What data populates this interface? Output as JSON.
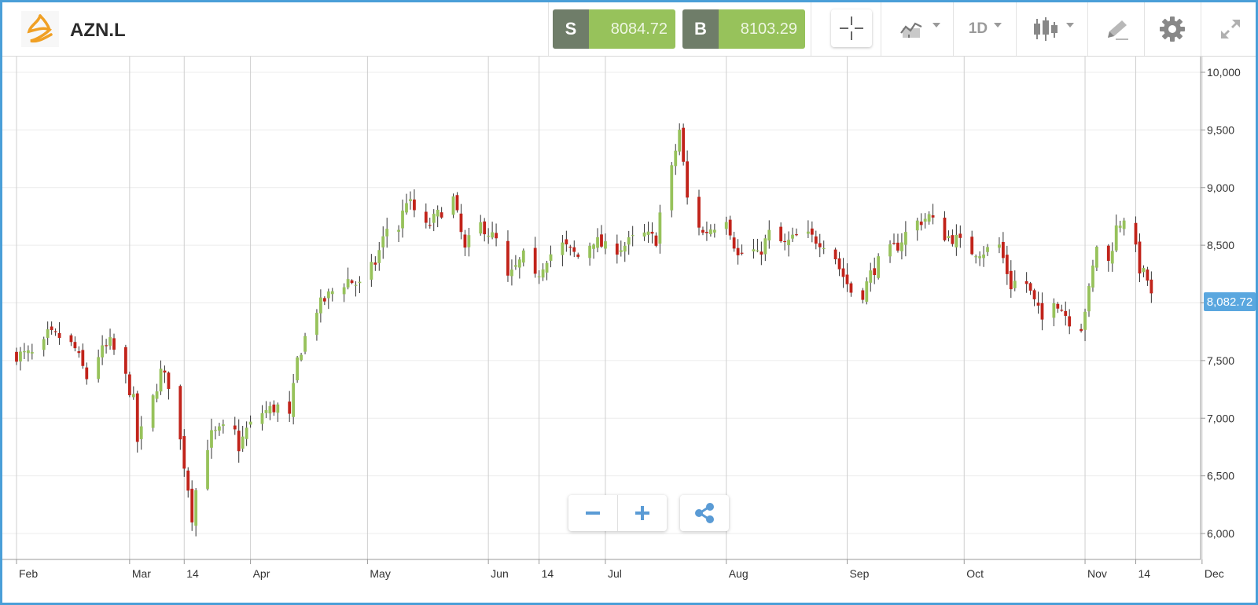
{
  "header": {
    "symbol": "AZN.L"
  },
  "trade": {
    "sell_label": "S",
    "sell_price": "8084.72",
    "buy_label": "B",
    "buy_price": "8103.29"
  },
  "toolbar": {
    "interval": "1D"
  },
  "chart": {
    "current_price_label": "8,082.72",
    "colors": {
      "up": "#97c25b",
      "down": "#c1231a",
      "accent": "#5aa7df",
      "grid": "#ececec",
      "month_line": "#cfcfcf"
    }
  },
  "icons": {
    "logo": "astrazeneca-logo",
    "crosshair": "crosshair-icon",
    "chart_type": "line-chart-icon",
    "candles": "candlestick-icon",
    "draw": "pencil-icon",
    "settings": "gear-icon",
    "expand": "expand-icon",
    "zoom_out": "minus-icon",
    "zoom_in": "plus-icon",
    "share": "share-icon"
  },
  "chart_data": {
    "type": "candlestick",
    "symbol": "AZN.L",
    "ylim": [
      5800,
      10100
    ],
    "yticks": [
      6000,
      6500,
      7000,
      7500,
      8000,
      8500,
      9000,
      9500,
      10000
    ],
    "ytick_labels": [
      "6,000",
      "6,500",
      "7,000",
      "7,500",
      "8,000",
      "8,500",
      "9,000",
      "9,500",
      "10,000"
    ],
    "xticks": [
      {
        "label": "Feb",
        "day": 0
      },
      {
        "label": "Mar",
        "day": 29
      },
      {
        "label": "14",
        "day": 43
      },
      {
        "label": "Apr",
        "day": 60
      },
      {
        "label": "May",
        "day": 90
      },
      {
        "label": "Jun",
        "day": 121
      },
      {
        "label": "14",
        "day": 134
      },
      {
        "label": "Jul",
        "day": 151
      },
      {
        "label": "Aug",
        "day": 182
      },
      {
        "label": "Sep",
        "day": 213
      },
      {
        "label": "Oct",
        "day": 243
      },
      {
        "label": "Nov",
        "day": 274
      },
      {
        "label": "14",
        "day": 287
      },
      {
        "label": "Dec",
        "day": 304
      }
    ],
    "keypoints": [
      [
        0,
        7550
      ],
      [
        6,
        7550
      ],
      [
        8,
        7720
      ],
      [
        12,
        7700
      ],
      [
        15,
        7600
      ],
      [
        18,
        7350
      ],
      [
        21,
        7550
      ],
      [
        24,
        7650
      ],
      [
        27,
        7450
      ],
      [
        30,
        7150
      ],
      [
        31,
        6800
      ],
      [
        34,
        7050
      ],
      [
        37,
        7400
      ],
      [
        39,
        7300
      ],
      [
        41,
        7000
      ],
      [
        44,
        6400
      ],
      [
        45,
        6150
      ],
      [
        47,
        6600
      ],
      [
        50,
        6850
      ],
      [
        53,
        6900
      ],
      [
        55,
        7000
      ],
      [
        57,
        6750
      ],
      [
        59,
        6900
      ],
      [
        63,
        7050
      ],
      [
        67,
        7100
      ],
      [
        70,
        7000
      ],
      [
        72,
        7500
      ],
      [
        74,
        7700
      ],
      [
        77,
        7950
      ],
      [
        81,
        8100
      ],
      [
        85,
        8200
      ],
      [
        88,
        8150
      ],
      [
        92,
        8350
      ],
      [
        96,
        8750
      ],
      [
        98,
        8650
      ],
      [
        100,
        8900
      ],
      [
        103,
        8750
      ],
      [
        105,
        8650
      ],
      [
        109,
        8800
      ],
      [
        112,
        8900
      ],
      [
        115,
        8450
      ],
      [
        118,
        8700
      ],
      [
        120,
        8650
      ],
      [
        124,
        8500
      ],
      [
        126,
        8200
      ],
      [
        130,
        8400
      ],
      [
        133,
        8200
      ],
      [
        136,
        8400
      ],
      [
        140,
        8500
      ],
      [
        144,
        8400
      ],
      [
        148,
        8550
      ],
      [
        152,
        8450
      ],
      [
        156,
        8500
      ],
      [
        160,
        8600
      ],
      [
        164,
        8550
      ],
      [
        166,
        9000
      ],
      [
        168,
        9150
      ],
      [
        170,
        9500
      ],
      [
        172,
        8900
      ],
      [
        174,
        8750
      ],
      [
        176,
        8600
      ],
      [
        178,
        8650
      ],
      [
        182,
        8750
      ],
      [
        185,
        8400
      ],
      [
        188,
        8500
      ],
      [
        190,
        8400
      ],
      [
        193,
        8600
      ],
      [
        197,
        8500
      ],
      [
        201,
        8600
      ],
      [
        205,
        8550
      ],
      [
        209,
        8500
      ],
      [
        211,
        8300
      ],
      [
        214,
        8100
      ],
      [
        216,
        8000
      ],
      [
        219,
        8250
      ],
      [
        222,
        8400
      ],
      [
        226,
        8500
      ],
      [
        228,
        8600
      ],
      [
        231,
        8700
      ],
      [
        234,
        8750
      ],
      [
        237,
        8600
      ],
      [
        241,
        8550
      ],
      [
        244,
        8450
      ],
      [
        248,
        8450
      ],
      [
        252,
        8500
      ],
      [
        255,
        8150
      ],
      [
        258,
        8250
      ],
      [
        261,
        8000
      ],
      [
        263,
        7850
      ],
      [
        266,
        8050
      ],
      [
        270,
        7850
      ],
      [
        273,
        7800
      ],
      [
        275,
        8100
      ],
      [
        277,
        8500
      ],
      [
        280,
        8350
      ],
      [
        282,
        8650
      ],
      [
        284,
        8750
      ],
      [
        286,
        8600
      ],
      [
        288,
        8300
      ],
      [
        290,
        8200
      ],
      [
        292,
        8100
      ]
    ],
    "last_close": 8082.72,
    "last_close_label": "8,082.72"
  }
}
